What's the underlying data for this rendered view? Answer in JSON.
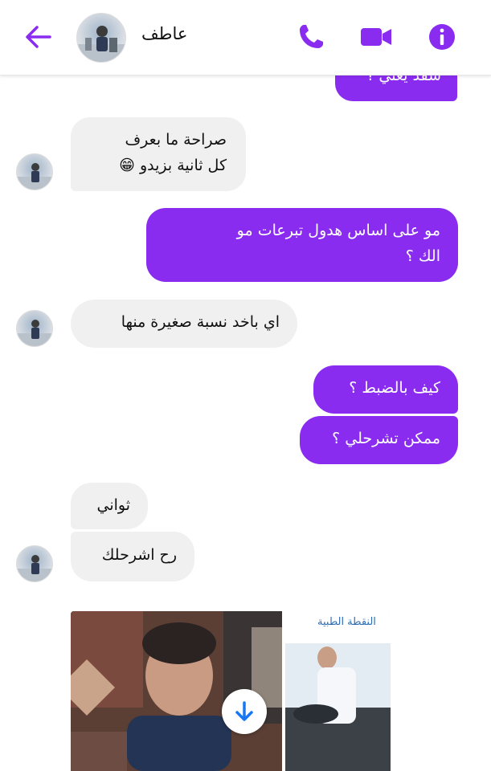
{
  "header": {
    "contact_name": "عاطف",
    "back_icon": "arrow-left-icon",
    "call_icon": "phone-icon",
    "video_icon": "video-camera-icon",
    "info_icon": "info-icon"
  },
  "colors": {
    "accent": "#8a2cf0",
    "incoming_bubble": "#f0f0f0"
  },
  "messages": [
    {
      "direction": "out",
      "text": "شقد يعني ؟"
    },
    {
      "direction": "in",
      "lines": [
        "صراحة ما بعرف",
        "كل ثانية بزيدو 😁"
      ]
    },
    {
      "direction": "out",
      "lines": [
        "مو على اساس هدول تبرعات مو",
        "الك ؟"
      ]
    },
    {
      "direction": "in",
      "text": "اي باخد نسبة صغيرة منها"
    },
    {
      "direction": "out",
      "text": "كيف بالضبط ؟"
    },
    {
      "direction": "out",
      "text": "ممكن تشرحلي ؟"
    },
    {
      "direction": "in",
      "text": "ثواني"
    },
    {
      "direction": "in",
      "text": "رح اشرحلك"
    }
  ],
  "attachment": {
    "download_icon": "download-arrow-icon",
    "photo_overlay_title": "النقطة الطبية"
  }
}
